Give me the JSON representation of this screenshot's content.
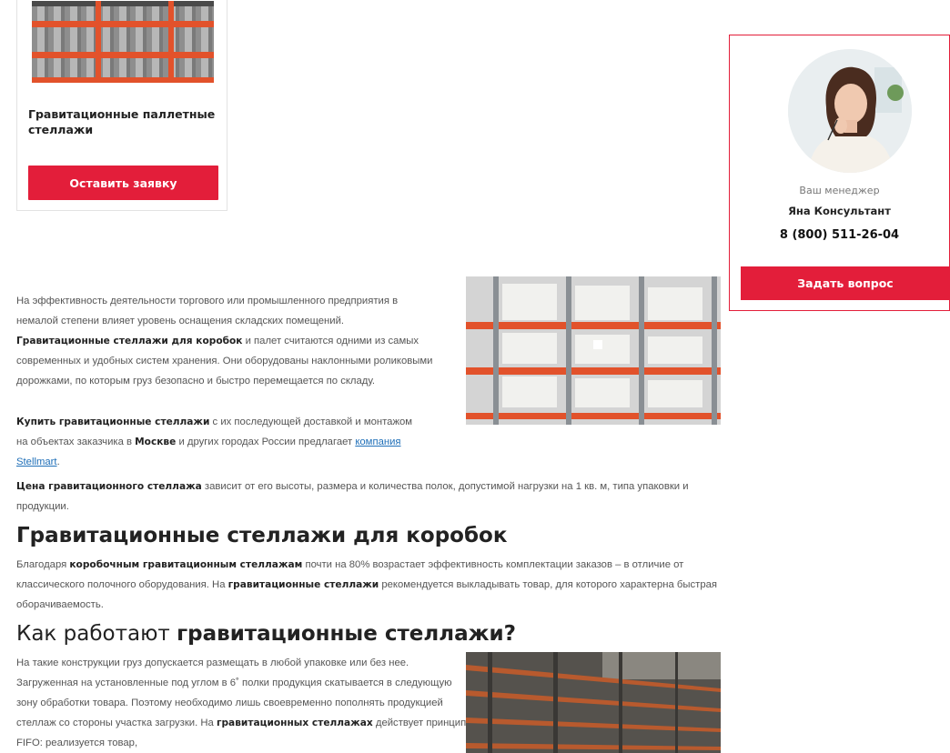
{
  "product_card": {
    "title": "Гравитационные паллетные стеллажи",
    "button_label": "Оставить заявку",
    "image_icon": "pallet-rack-image"
  },
  "manager": {
    "label": "Ваш менеджер",
    "name": "Яна Консультант",
    "phone": "8 (800) 511-26-04",
    "button_label": "Задать вопрос",
    "avatar_icon": "manager-avatar"
  },
  "article": {
    "p1": {
      "t1": "На эффективность деятельности торгового или промышленного предприятия в немалой степени влияет уровень оснащения складских помещений. ",
      "b1": "Гравитационные стеллажи для коробок",
      "t2": " и палет считаются одними из самых современных и удобных систем хранения. Они оборудованы наклонными роликовыми дорожками, по которым груз безопасно и быстро перемещается по складу."
    },
    "p2": {
      "b1": "Купить гравитационные стеллажи",
      "t1": " с их последующей доставкой и монтажом на объектах заказчика в ",
      "b2": "Москве",
      "t2": " и других городах России предлагает ",
      "link": "компания Stellmart",
      "t3": "."
    },
    "p3": {
      "b1": "Цена гравитационного стеллажа",
      "t1": " зависит от его высоты, размера и количества полок, допустимой нагрузки на 1 кв. м, типа упаковки и продукции."
    },
    "h2_1": "Гравитационные стеллажи для коробок",
    "p4": {
      "t1": "Благодаря ",
      "b1": "коробочным гравитационным стеллажам",
      "t2": " почти на 80% возрастает эффективность комплектации заказов – в отличие от классического полочного оборудования. На ",
      "b2": "гравитационные стеллажи",
      "t3": " рекомендуется выкладывать товар, для которого характерна быстрая оборачиваемость."
    },
    "h2_2": {
      "plain": "Как работают ",
      "bold": "гравитационные стеллажи?"
    },
    "p5": {
      "t1": "На такие конструкции груз допускается размещать в любой упаковке или без нее. Загруженная на установленные под углом в 6˚ полки продукция скатывается в следующую зону обработки товара. Поэтому необходимо лишь своевременно пополнять продукцией стеллаж со стороны участка загрузки. На ",
      "b1": "гравитационных стеллажах",
      "t2": " действует принцип FIFO: реализуется товар,"
    },
    "image1_icon": "gravity-rack-boxes-photo",
    "image2_icon": "warehouse-rack-photo"
  },
  "colors": {
    "accent_red": "#e31e3a",
    "link_blue": "#1f6fb8",
    "rack_orange": "#e2522b"
  }
}
